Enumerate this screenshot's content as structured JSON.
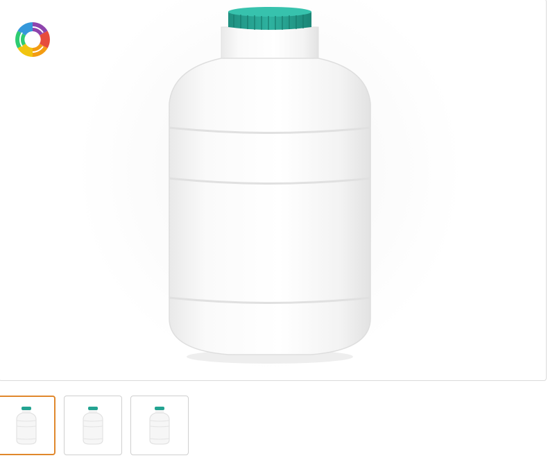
{
  "gallery": {
    "brand_logo": {
      "icon": "spiral-rainbow-logo-icon"
    },
    "main_image": {
      "icon": "white-plastic-jerrycan-with-teal-cap-icon"
    },
    "thumbnails": [
      {
        "icon": "jerrycan-thumbnail-icon",
        "selected": true
      },
      {
        "icon": "jerrycan-thumbnail-icon",
        "selected": false
      },
      {
        "icon": "jerrycan-thumbnail-icon",
        "selected": false
      }
    ],
    "colors": {
      "cap": "#23a391",
      "body": "#ffffff",
      "active_border": "#e0872b",
      "border": "#d9d9d9"
    }
  }
}
